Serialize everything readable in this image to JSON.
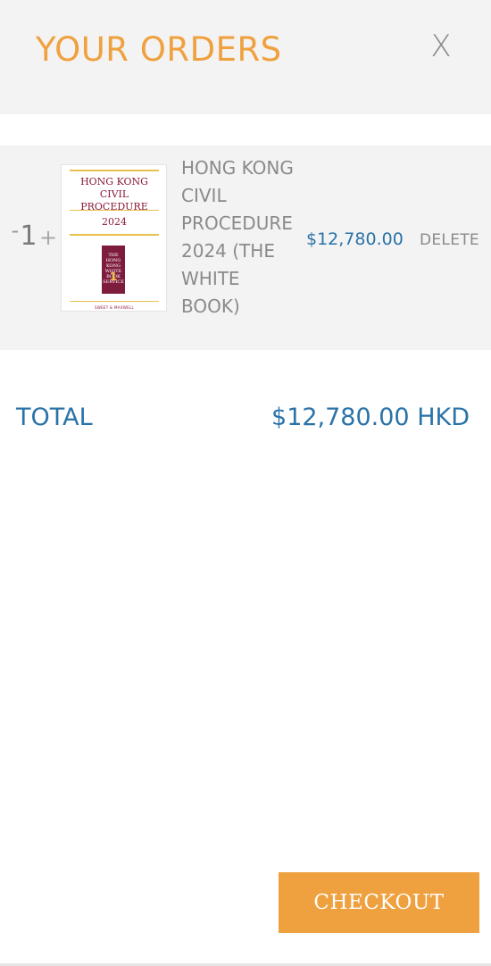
{
  "header": {
    "title": "YOUR ORDERS",
    "close_label": "X"
  },
  "order": {
    "quantity": {
      "minus_label": "-",
      "value": "1",
      "plus_label": "+"
    },
    "product": {
      "name": "HONG KONG CIVIL PROCEDURE 2024 (THE WHITE BOOK)",
      "price": "$12,780.00",
      "cover": {
        "title": "HONG KONG CIVIL PROCEDURE",
        "year": "2024",
        "book_label": "THE HONG KONG WHITE BOOK SERVICE",
        "book_number": "1",
        "publisher": "SWEET & MAXWELL"
      }
    },
    "delete_label": "DELETE"
  },
  "total": {
    "label": "TOTAL",
    "value": "$12,780.00 HKD"
  },
  "checkout": {
    "label": "CHECKOUT"
  },
  "colors": {
    "accent_orange": "#f0a13f",
    "price_blue": "#2a73a8",
    "muted_gray": "#8a8a8a",
    "panel_bg": "#f3f3f3",
    "cover_maroon": "#8b1a3a"
  },
  "icons": {
    "close": "close-icon"
  }
}
